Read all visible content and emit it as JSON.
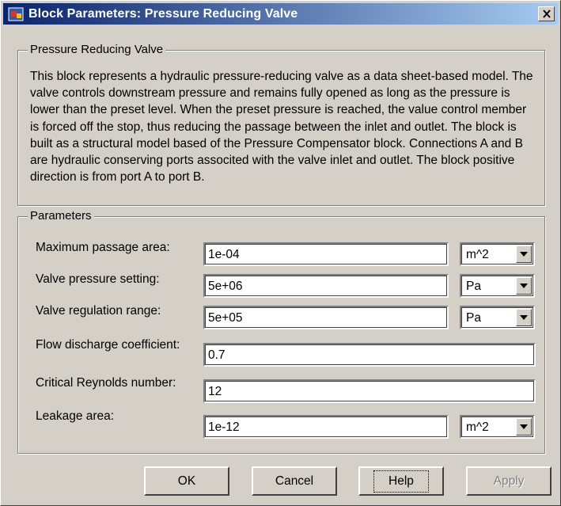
{
  "window": {
    "title": "Block Parameters: Pressure Reducing Valve",
    "close_label": "X"
  },
  "description_group": {
    "legend": "Pressure Reducing Valve",
    "text": "This block represents a hydraulic pressure-reducing valve as a data sheet-based model. The valve controls downstream pressure and remains fully opened as long as the pressure is lower than the preset level. When the preset pressure is reached, the value control member is forced off the stop, thus reducing the passage between the inlet and outlet. The block is built as a structural model based of the Pressure Compensator block. Connections A and B are hydraulic conserving ports associted with the valve inlet and outlet. The block positive direction is from port A to port B."
  },
  "parameters_group": {
    "legend": "Parameters",
    "rows": [
      {
        "label": "Maximum passage area:",
        "value": "1e-04",
        "unit": "m^2"
      },
      {
        "label": "Valve pressure setting:",
        "value": "5e+06",
        "unit": "Pa"
      },
      {
        "label": "Valve regulation range:",
        "value": "5e+05",
        "unit": "Pa"
      },
      {
        "label": "Flow discharge coefficient:",
        "value": "0.7"
      },
      {
        "label": "Critical Reynolds number:",
        "value": "12"
      },
      {
        "label": "Leakage area:",
        "value": "1e-12",
        "unit": "m^2"
      }
    ]
  },
  "buttons": {
    "ok": "OK",
    "cancel": "Cancel",
    "help": "Help",
    "apply": "Apply"
  },
  "icons": {
    "app": "simulink-block-icon",
    "dropdown": "chevron-down-icon"
  },
  "colors": {
    "titlebar_start": "#0a246a",
    "titlebar_end": "#a6caf0",
    "dialog_bg": "#d4d0c8"
  }
}
